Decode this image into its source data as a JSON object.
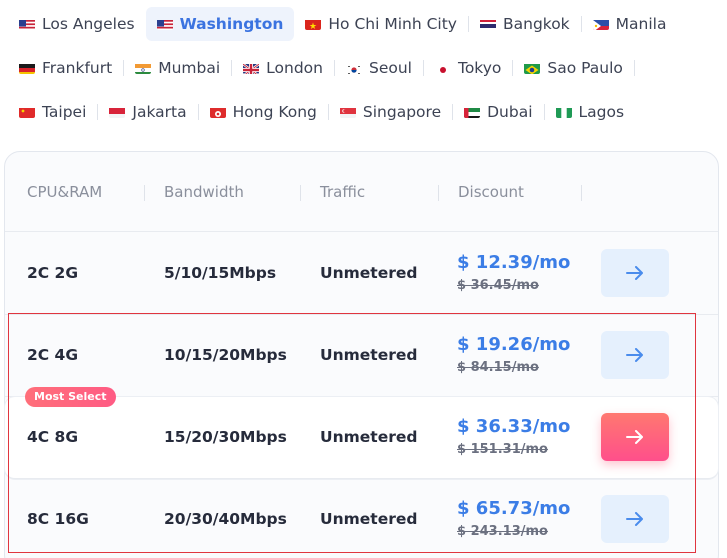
{
  "locations": [
    [
      {
        "label": "Los Angeles",
        "flag": "us-flag-icon"
      },
      {
        "label": "Washington",
        "flag": "us-flag-icon",
        "active": true
      },
      {
        "label": "Ho Chi Minh City",
        "flag": "vietnam-flag-icon"
      },
      {
        "label": "Bangkok",
        "flag": "thailand-flag-icon"
      },
      {
        "label": "Manila",
        "flag": "philippines-flag-icon"
      }
    ],
    [
      {
        "label": "Frankfurt",
        "flag": "germany-flag-icon"
      },
      {
        "label": "Mumbai",
        "flag": "india-flag-icon"
      },
      {
        "label": "London",
        "flag": "uk-flag-icon"
      },
      {
        "label": "Seoul",
        "flag": "korea-flag-icon"
      },
      {
        "label": "Tokyo",
        "flag": "japan-flag-icon"
      },
      {
        "label": "Sao Paulo",
        "flag": "brazil-flag-icon"
      }
    ],
    [
      {
        "label": "Taipei",
        "flag": "taiwan-flag-icon"
      },
      {
        "label": "Jakarta",
        "flag": "indonesia-flag-icon"
      },
      {
        "label": "Hong Kong",
        "flag": "hongkong-flag-icon"
      },
      {
        "label": "Singapore",
        "flag": "singapore-flag-icon"
      },
      {
        "label": "Dubai",
        "flag": "uae-flag-icon"
      },
      {
        "label": "Lagos",
        "flag": "nigeria-flag-icon"
      }
    ]
  ],
  "table": {
    "headers": [
      "CPU&RAM",
      "Bandwidth",
      "Traffic",
      "Discount"
    ],
    "rows": [
      {
        "cpu_ram": "2C 2G",
        "bandwidth": "5/10/15Mbps",
        "traffic": "Unmetered",
        "price": "$ 12.39/mo",
        "old_price": "$ 36.45/mo"
      },
      {
        "cpu_ram": "2C 4G",
        "bandwidth": "10/15/20Mbps",
        "traffic": "Unmetered",
        "price": "$ 19.26/mo",
        "old_price": "$ 84.15/mo"
      },
      {
        "cpu_ram": "4C 8G",
        "bandwidth": "15/20/30Mbps",
        "traffic": "Unmetered",
        "price": "$ 36.33/mo",
        "old_price": "$ 151.31/mo",
        "badge": "Most Select",
        "featured": true
      },
      {
        "cpu_ram": "8C 16G",
        "bandwidth": "20/30/40Mbps",
        "traffic": "Unmetered",
        "price": "$ 65.73/mo",
        "old_price": "$ 243.13/mo"
      }
    ]
  },
  "colors": {
    "accent": "#3b73e0",
    "price": "#3b7de6",
    "hot_start": "#ff7870",
    "hot_end": "#ff4f8b",
    "highlight": "#e0353f"
  },
  "icons": {
    "row_action": "arrow-right-icon"
  }
}
